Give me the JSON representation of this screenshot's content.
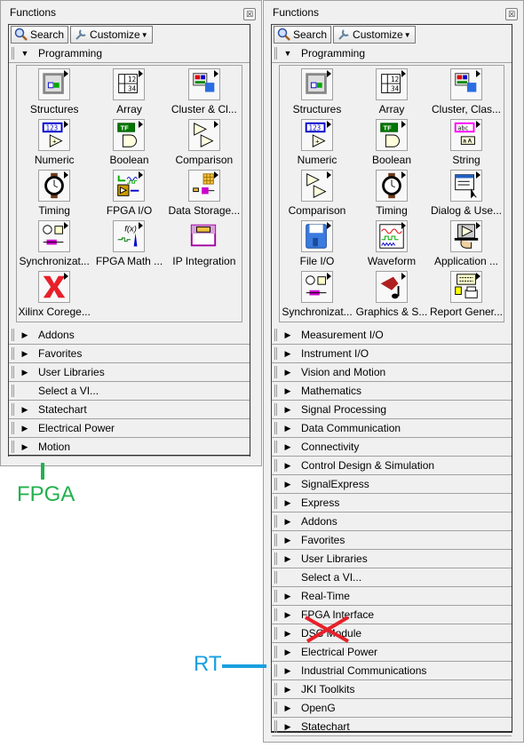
{
  "annotations": {
    "fpga_label": "FPGA",
    "rt_label": "RT",
    "fpga_color": "#22b14c",
    "rt_color": "#1a9fe0",
    "cross_color": "#e8202a"
  },
  "left_palette": {
    "title": "Functions",
    "search_label": "Search",
    "customize_label": "Customize",
    "expanded_category": "Programming",
    "icons": [
      {
        "label": "Structures",
        "icon": "structures-icon"
      },
      {
        "label": "Array",
        "icon": "array-icon"
      },
      {
        "label": "Cluster & Cl...",
        "icon": "cluster-icon"
      },
      {
        "label": "Numeric",
        "icon": "numeric-icon"
      },
      {
        "label": "Boolean",
        "icon": "boolean-icon"
      },
      {
        "label": "Comparison",
        "icon": "comparison-icon"
      },
      {
        "label": "Timing",
        "icon": "timing-icon"
      },
      {
        "label": "FPGA I/O",
        "icon": "fpga-io-icon"
      },
      {
        "label": "Data Storage...",
        "icon": "data-storage-icon"
      },
      {
        "label": "Synchronizat...",
        "icon": "synchronization-icon"
      },
      {
        "label": "FPGA Math ...",
        "icon": "fpga-math-icon"
      },
      {
        "label": "IP Integration",
        "icon": "ip-integration-icon"
      },
      {
        "label": "Xilinx Corege...",
        "icon": "xilinx-icon"
      }
    ],
    "categories": [
      {
        "label": "Addons",
        "expandable": true
      },
      {
        "label": "Favorites",
        "expandable": true
      },
      {
        "label": "User Libraries",
        "expandable": true
      },
      {
        "label": "Select a VI...",
        "expandable": false
      },
      {
        "label": "Statechart",
        "expandable": true
      },
      {
        "label": "Electrical Power",
        "expandable": true
      },
      {
        "label": "Motion",
        "expandable": true
      }
    ]
  },
  "right_palette": {
    "title": "Functions",
    "search_label": "Search",
    "customize_label": "Customize",
    "expanded_category": "Programming",
    "icons": [
      {
        "label": "Structures",
        "icon": "structures-icon"
      },
      {
        "label": "Array",
        "icon": "array-icon"
      },
      {
        "label": "Cluster, Clas...",
        "icon": "cluster-icon"
      },
      {
        "label": "Numeric",
        "icon": "numeric-icon"
      },
      {
        "label": "Boolean",
        "icon": "boolean-icon"
      },
      {
        "label": "String",
        "icon": "string-icon"
      },
      {
        "label": "Comparison",
        "icon": "comparison-icon"
      },
      {
        "label": "Timing",
        "icon": "timing-icon"
      },
      {
        "label": "Dialog & Use...",
        "icon": "dialog-icon"
      },
      {
        "label": "File I/O",
        "icon": "file-io-icon"
      },
      {
        "label": "Waveform",
        "icon": "waveform-icon"
      },
      {
        "label": "Application ...",
        "icon": "application-control-icon"
      },
      {
        "label": "Synchronizat...",
        "icon": "synchronization-icon"
      },
      {
        "label": "Graphics & S...",
        "icon": "graphics-sound-icon"
      },
      {
        "label": "Report Gener...",
        "icon": "report-generation-icon"
      }
    ],
    "categories": [
      {
        "label": "Measurement I/O",
        "expandable": true
      },
      {
        "label": "Instrument I/O",
        "expandable": true
      },
      {
        "label": "Vision and Motion",
        "expandable": true
      },
      {
        "label": "Mathematics",
        "expandable": true
      },
      {
        "label": "Signal Processing",
        "expandable": true
      },
      {
        "label": "Data Communication",
        "expandable": true
      },
      {
        "label": "Connectivity",
        "expandable": true
      },
      {
        "label": "Control Design & Simulation",
        "expandable": true
      },
      {
        "label": "SignalExpress",
        "expandable": true
      },
      {
        "label": "Express",
        "expandable": true
      },
      {
        "label": "Addons",
        "expandable": true
      },
      {
        "label": "Favorites",
        "expandable": true
      },
      {
        "label": "User Libraries",
        "expandable": true
      },
      {
        "label": "Select a VI...",
        "expandable": false
      },
      {
        "label": "Real-Time",
        "expandable": true
      },
      {
        "label": "FPGA Interface",
        "expandable": true
      },
      {
        "label": "DSC Module",
        "expandable": true
      },
      {
        "label": "Electrical Power",
        "expandable": true
      },
      {
        "label": "Industrial Communications",
        "expandable": true
      },
      {
        "label": "JKI Toolkits",
        "expandable": true
      },
      {
        "label": "OpenG",
        "expandable": true
      },
      {
        "label": "Statechart",
        "expandable": true
      }
    ]
  }
}
